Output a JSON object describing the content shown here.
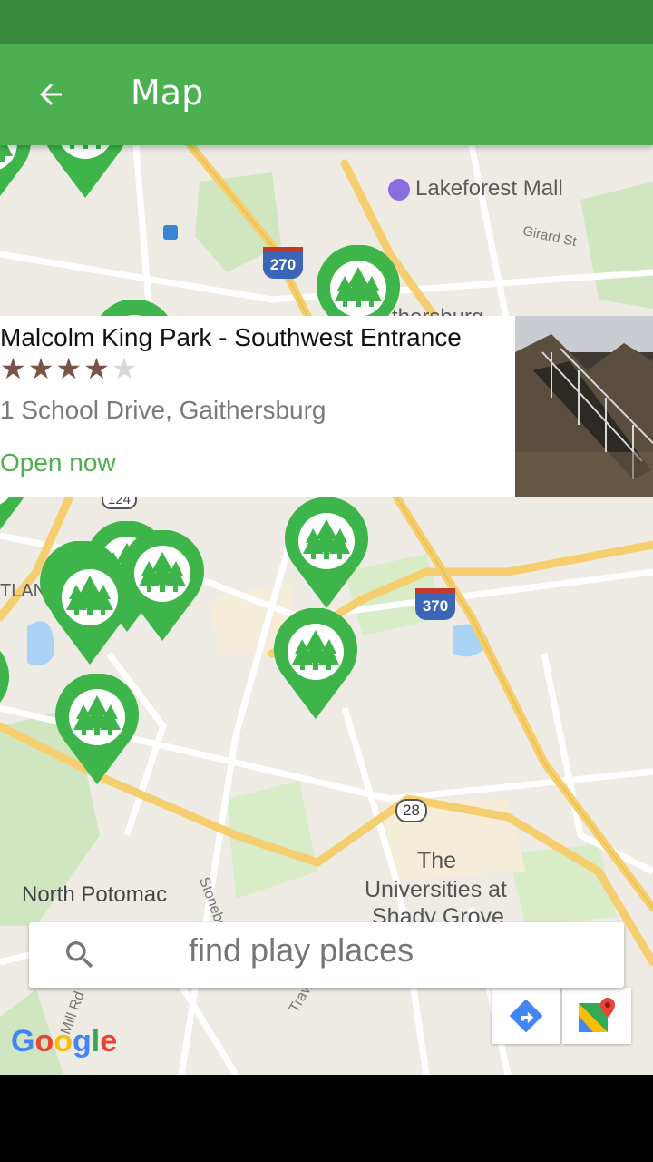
{
  "app_bar": {
    "title": "Map",
    "back_icon": "arrow-back-icon",
    "color": "#4caf50",
    "status_bar_color": "#3a8a3e"
  },
  "map": {
    "labels": {
      "lakeforest": "Lakeforest Mall",
      "girard": "Girard St",
      "gaithersburg": "thersburg",
      "route_124": "124",
      "atlan": "TLAN",
      "interstate_270": "270",
      "interstate_370": "370",
      "route_28": "28",
      "north_potomac": "North Potomac",
      "universities_1": "The",
      "universities_2": "Universities at",
      "universities_3": "Shady Grove",
      "stonebridge": "Stonebrid",
      "travilah": "Travila",
      "mill_rd": "Mill Rd"
    },
    "pin_icon": "park-trees-icon",
    "pin_color": "#3db54a"
  },
  "info_card": {
    "name": "Malcolm King Park - Southwest Entrance",
    "rating": 4,
    "max_rating": 5,
    "address": "1 School Drive, Gaithersburg",
    "status": "Open now",
    "status_color": "#4caf50",
    "star_color": "#795548"
  },
  "search": {
    "placeholder": "find play places",
    "icon": "search-icon"
  },
  "map_buttons": {
    "directions_icon": "directions-icon",
    "google_maps_icon": "google-maps-icon"
  },
  "attribution": "Google"
}
